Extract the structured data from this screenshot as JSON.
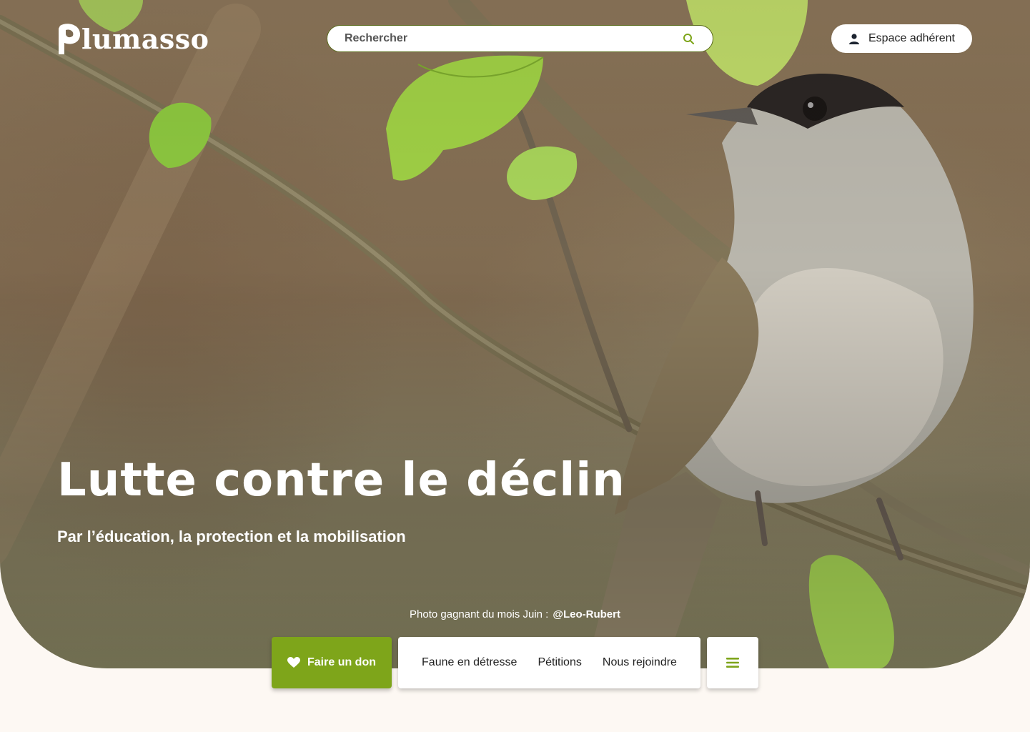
{
  "brand": {
    "name": "Plumasso",
    "logo_text": "lumasso",
    "logo_initial": "P"
  },
  "search": {
    "placeholder": "Rechercher"
  },
  "account": {
    "label": "Espace adhérent",
    "icon": "user-icon"
  },
  "hero": {
    "title": "Lutte contre le déclin",
    "subtitle": "Par l’éducation, la protection et la mobilisation",
    "photo_credit_prefix": "Photo gagnant du mois  Juin :",
    "photo_credit_handle": "@Leo-Rubert"
  },
  "actions": {
    "donate_label": "Faire un don",
    "donate_icon": "heart-icon"
  },
  "nav": {
    "items": [
      {
        "label": "Faune en détresse"
      },
      {
        "label": "Pétitions"
      },
      {
        "label": "Nous rejoindre"
      }
    ],
    "menu_icon": "hamburger-menu-icon"
  },
  "colors": {
    "accent": "#7ea51a",
    "page_bg": "#fdf8f3",
    "search_border": "#5a6b1c"
  }
}
